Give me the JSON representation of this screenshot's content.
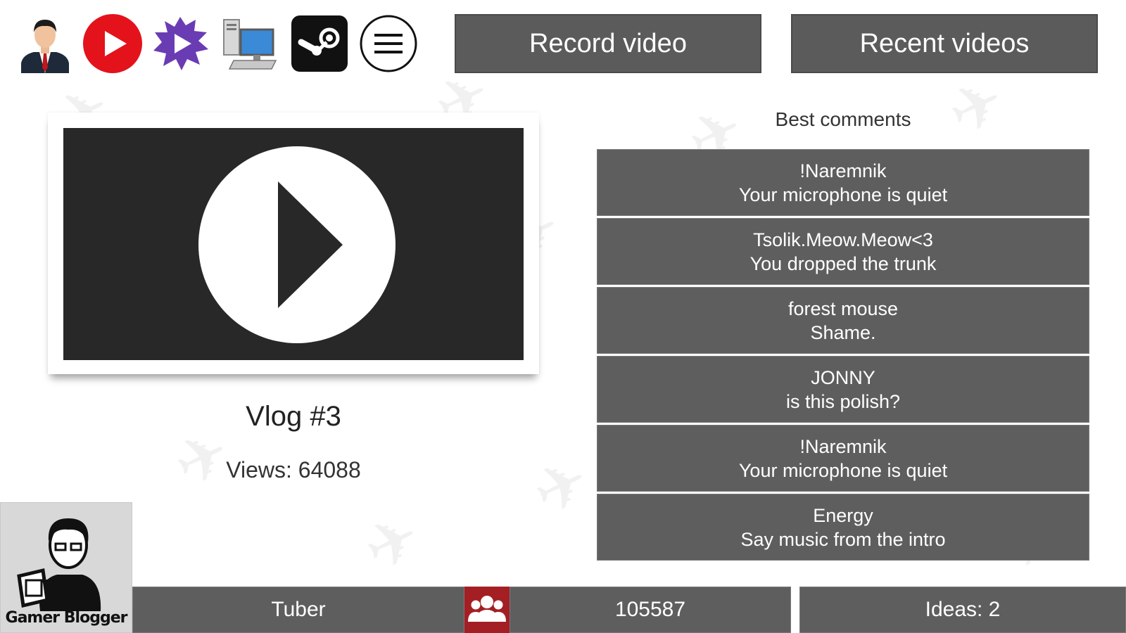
{
  "topbar": {
    "icons": [
      "businessman-icon",
      "youtube-icon",
      "twitch-splash-icon",
      "computer-icon",
      "steam-icon",
      "menu-icon"
    ],
    "record_label": "Record video",
    "recent_label": "Recent videos"
  },
  "video": {
    "title": "Vlog #3",
    "views_text": "Views: 64088"
  },
  "comments": {
    "header": "Best comments",
    "items": [
      {
        "author": "!Naremnik",
        "text": "Your microphone is quiet"
      },
      {
        "author": "Tsolik.Meow.Meow<3",
        "text": "You dropped the trunk"
      },
      {
        "author": "forest mouse",
        "text": "Shame."
      },
      {
        "author": "JONNY",
        "text": "is this polish?"
      },
      {
        "author": "!Naremnik",
        "text": "Your microphone is quiet"
      },
      {
        "author": "Energy",
        "text": "Say music from the intro"
      }
    ]
  },
  "profile": {
    "caption": "Gamer Blogger"
  },
  "status": {
    "rank": "Tuber",
    "subscribers": "105587",
    "ideas": "Ideas: 2"
  },
  "colors": {
    "panel": "#5e5e5e",
    "button": "#5b5b5b",
    "video_bg": "#282828",
    "accent_red": "#e4121b",
    "subs_red": "#a31f24",
    "twitch_purple": "#6a3cb4"
  }
}
